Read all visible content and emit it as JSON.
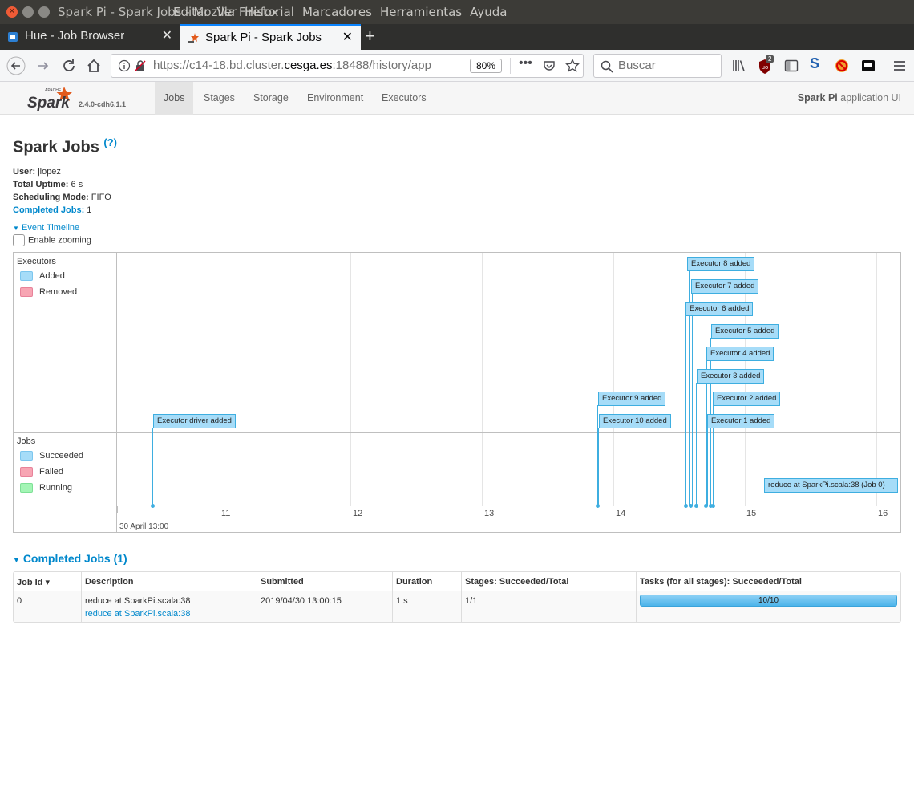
{
  "window": {
    "title_overlap": "Spark Pi - Spark Jobs - Mozilla Firefox",
    "menu": [
      "Editar",
      "Ver",
      "Historial",
      "Marcadores",
      "Herramientas",
      "Ayuda"
    ]
  },
  "tabs": [
    {
      "label": "Hue - Job Browser"
    },
    {
      "label": "Spark Pi - Spark Jobs"
    }
  ],
  "browser": {
    "url_prefix": "https://c14-18.bd.cluster.",
    "url_domain": "cesga.es",
    "url_suffix": ":18488/history/app",
    "zoom": "80%",
    "search_placeholder": "Buscar",
    "ublock_badge": "2"
  },
  "spark": {
    "version": "2.4.0-cdh6.1.1",
    "nav": [
      "Jobs",
      "Stages",
      "Storage",
      "Environment",
      "Executors"
    ],
    "app_name": "Spark Pi",
    "app_ui_suffix": " application UI"
  },
  "page": {
    "title": "Spark Jobs",
    "help": "(?)",
    "user_label": "User:",
    "user": "jlopez",
    "uptime_label": "Total Uptime:",
    "uptime": "6 s",
    "sched_label": "Scheduling Mode:",
    "sched": "FIFO",
    "completed_label": "Completed Jobs:",
    "completed": "1",
    "event_timeline": "Event Timeline",
    "enable_zooming": "Enable zooming"
  },
  "timeline": {
    "executors_label": "Executors",
    "executor_legend": [
      "Added",
      "Removed"
    ],
    "jobs_label": "Jobs",
    "jobs_legend": [
      "Succeeded",
      "Failed",
      "Running"
    ],
    "ticks": [
      "11",
      "12",
      "13",
      "14",
      "15",
      "16"
    ],
    "date_label": "30 April 13:00",
    "executor_events": [
      "Executor driver added",
      "Executor 9 added",
      "Executor 10 added",
      "Executor 8 added",
      "Executor 7 added",
      "Executor 6 added",
      "Executor 5 added",
      "Executor 4 added",
      "Executor 3 added",
      "Executor 2 added",
      "Executor 1 added"
    ],
    "job_events": [
      "reduce at SparkPi.scala:38 (Job 0)"
    ]
  },
  "completed_jobs": {
    "header": "Completed Jobs (1)",
    "columns": [
      "Job Id ▾",
      "Description",
      "Submitted",
      "Duration",
      "Stages: Succeeded/Total",
      "Tasks (for all stages): Succeeded/Total"
    ],
    "rows": [
      {
        "job_id": "0",
        "description": "reduce at SparkPi.scala:38",
        "description_link": "reduce at SparkPi.scala:38",
        "submitted": "2019/04/30 13:00:15",
        "duration": "1 s",
        "stages": "1/1",
        "tasks": "10/10",
        "tasks_fraction": 1.0
      }
    ]
  },
  "colors": {
    "link": "#0088cc",
    "added": "#a6dcf8",
    "removed": "#f7a5b3",
    "running": "#a3f5b5"
  }
}
